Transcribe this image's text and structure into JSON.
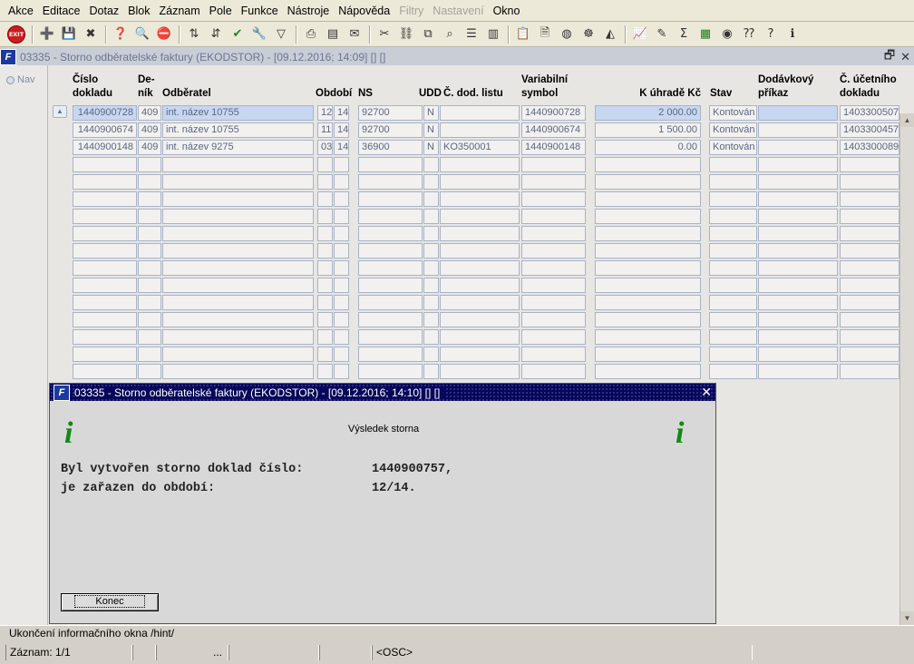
{
  "menu": [
    "Akce",
    "Editace",
    "Dotaz",
    "Blok",
    "Záznam",
    "Pole",
    "Funkce",
    "Nástroje",
    "Nápověda",
    "Filtry",
    "Nastavení",
    "Okno"
  ],
  "menu_disabled": [
    "Filtry",
    "Nastavení"
  ],
  "toolbar_exit_label": "EXIT",
  "main_window": {
    "title": "03335 - Storno odběratelské faktury (EKODSTOR) - [09.12.2016; 14:09]  []  []",
    "nav_label": "Nav"
  },
  "table": {
    "headers": {
      "cislo": [
        "Číslo",
        "dokladu"
      ],
      "denik": [
        "De-",
        "ník"
      ],
      "odberatel": "Odběratel",
      "obdobi": "Období",
      "ns": "NS",
      "udd": "UDD",
      "dod_list": "Č. dod. listu",
      "var_symbol": [
        "Variabilní",
        "symbol"
      ],
      "k_uhrade": "K úhradě Kč",
      "stav": "Stav",
      "dod_prikaz": [
        "Dodávkový",
        "příkaz"
      ],
      "ucetni": [
        "Č. účetního",
        "dokladu"
      ]
    },
    "rows": [
      {
        "cislo": "1440900728",
        "denik": "409",
        "odberatel": "int. název 10755",
        "obd_m": "12",
        "obd_r": "14",
        "ns": "92700",
        "udd": "N",
        "dod_list": "",
        "var_symbol": "1440900728",
        "k_uhrade": "2 000.00",
        "stav": "Kontován",
        "dod_prikaz": "",
        "ucetni": "1403300507"
      },
      {
        "cislo": "1440900674",
        "denik": "409",
        "odberatel": "int. název 10755",
        "obd_m": "11",
        "obd_r": "14",
        "ns": "92700",
        "udd": "N",
        "dod_list": "",
        "var_symbol": "1440900674",
        "k_uhrade": "1 500.00",
        "stav": "Kontován",
        "dod_prikaz": "",
        "ucetni": "1403300457"
      },
      {
        "cislo": "1440900148",
        "denik": "409",
        "odberatel": "int. název 9275",
        "obd_m": "03",
        "obd_r": "14",
        "ns": "36900",
        "udd": "N",
        "dod_list": "KO350001",
        "var_symbol": "1440900148",
        "k_uhrade": "0.00",
        "stav": "Kontován",
        "dod_prikaz": "",
        "ucetni": "1403300089"
      }
    ]
  },
  "dialog": {
    "title": "03335 - Storno odběratelské faktury (EKODSTOR) - [09.12.2016; 14:10]  []  []",
    "info_glyph": "i",
    "heading": "Výsledek storna",
    "line1_label": "Byl vytvořen storno doklad číslo:",
    "line1_value": "1440900757,",
    "line2_label": "je zařazen do období:",
    "line2_value": "12/14.",
    "button_label": "Konec"
  },
  "status": {
    "hint": "Ukončení informačního okna /hint/",
    "record": "Záznam: 1/1",
    "ellipsis": "...",
    "mode": "<OSC>"
  }
}
